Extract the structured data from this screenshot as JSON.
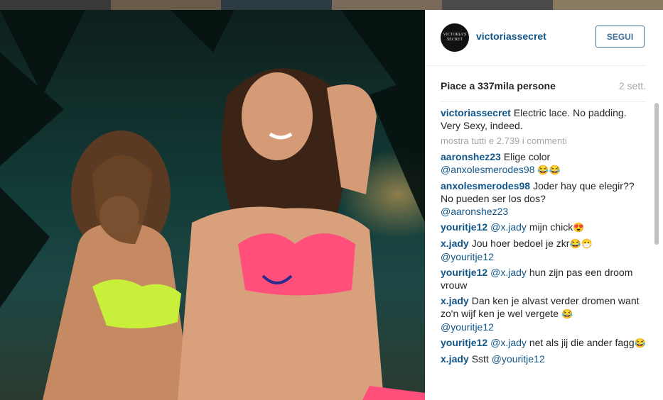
{
  "post": {
    "account": {
      "username": "victoriassecret",
      "avatar_text": "VICTORIA'S SECRET",
      "follow_label": "SEGUI"
    },
    "likes": "Piace a 337mila persone",
    "age": "2 sett.",
    "caption": {
      "user": "victoriassecret",
      "text": "Electric lace. No padding. Very Sexy, indeed."
    },
    "view_all": "mostra tutti e 2.739 i commenti",
    "comments": [
      {
        "user": "aaronshez23",
        "text": "Elige color",
        "mention": "@anxolesmerodes98",
        "emoji": "😂😂"
      },
      {
        "user": "anxolesmerodes98",
        "text": "Joder hay que elegir?? No pueden ser los dos?",
        "mention": "@aaronshez23",
        "emoji": ""
      },
      {
        "user": "youritje12",
        "text": "mijn chick",
        "mention": "@x.jady",
        "emoji": "😍"
      },
      {
        "user": "x.jady",
        "text": "Jou hoer bedoel je zkr",
        "mention": "@youritje12",
        "emoji": "😂😷"
      },
      {
        "user": "youritje12",
        "text": "hun zijn pas een droom vrouw",
        "mention": "@x.jady",
        "emoji": ""
      },
      {
        "user": "x.jady",
        "text": "Dan ken je alvast verder dromen want zo'n wijf ken je wel vergete",
        "mention": "@youritje12",
        "emoji": "😂"
      },
      {
        "user": "youritje12",
        "text": "net als jij die ander fagg",
        "mention": "@x.jady",
        "emoji": "😂"
      },
      {
        "user": "x.jady",
        "text": "Sstt",
        "mention": "@youritje12",
        "emoji": ""
      }
    ]
  },
  "colors": {
    "link": "#125688",
    "follow": "#3f729b",
    "muted": "#a5a7aa",
    "text": "#262626"
  },
  "icons": {
    "avatar": "victorias-secret-logo"
  }
}
